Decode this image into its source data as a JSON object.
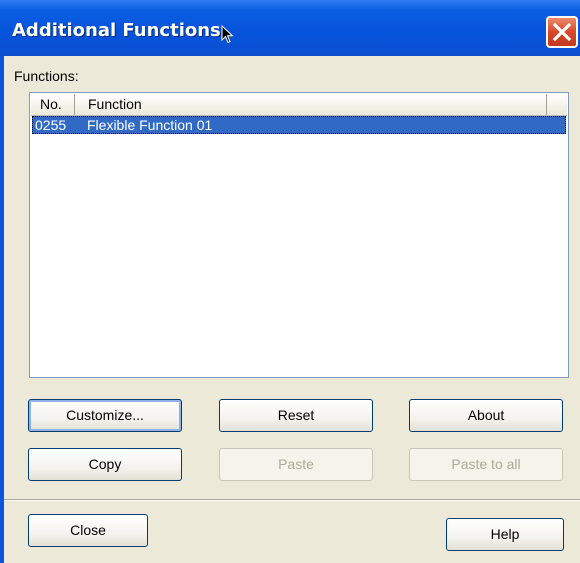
{
  "window": {
    "title": "Additional Functions"
  },
  "functions_label": "Functions:",
  "list": {
    "columns": [
      "No.",
      "Function"
    ],
    "rows": [
      {
        "no": "0255",
        "function": "Flexible Function 01",
        "selected": true
      }
    ]
  },
  "buttons": {
    "customize": "Customize...",
    "reset": "Reset",
    "about": "About",
    "copy": "Copy",
    "paste": "Paste",
    "paste_to_all": "Paste to all",
    "close": "Close",
    "help": "Help"
  },
  "colors": {
    "titlebar": "#0654dc",
    "selection": "#316ac5",
    "dialog_bg": "#ece9d8"
  }
}
